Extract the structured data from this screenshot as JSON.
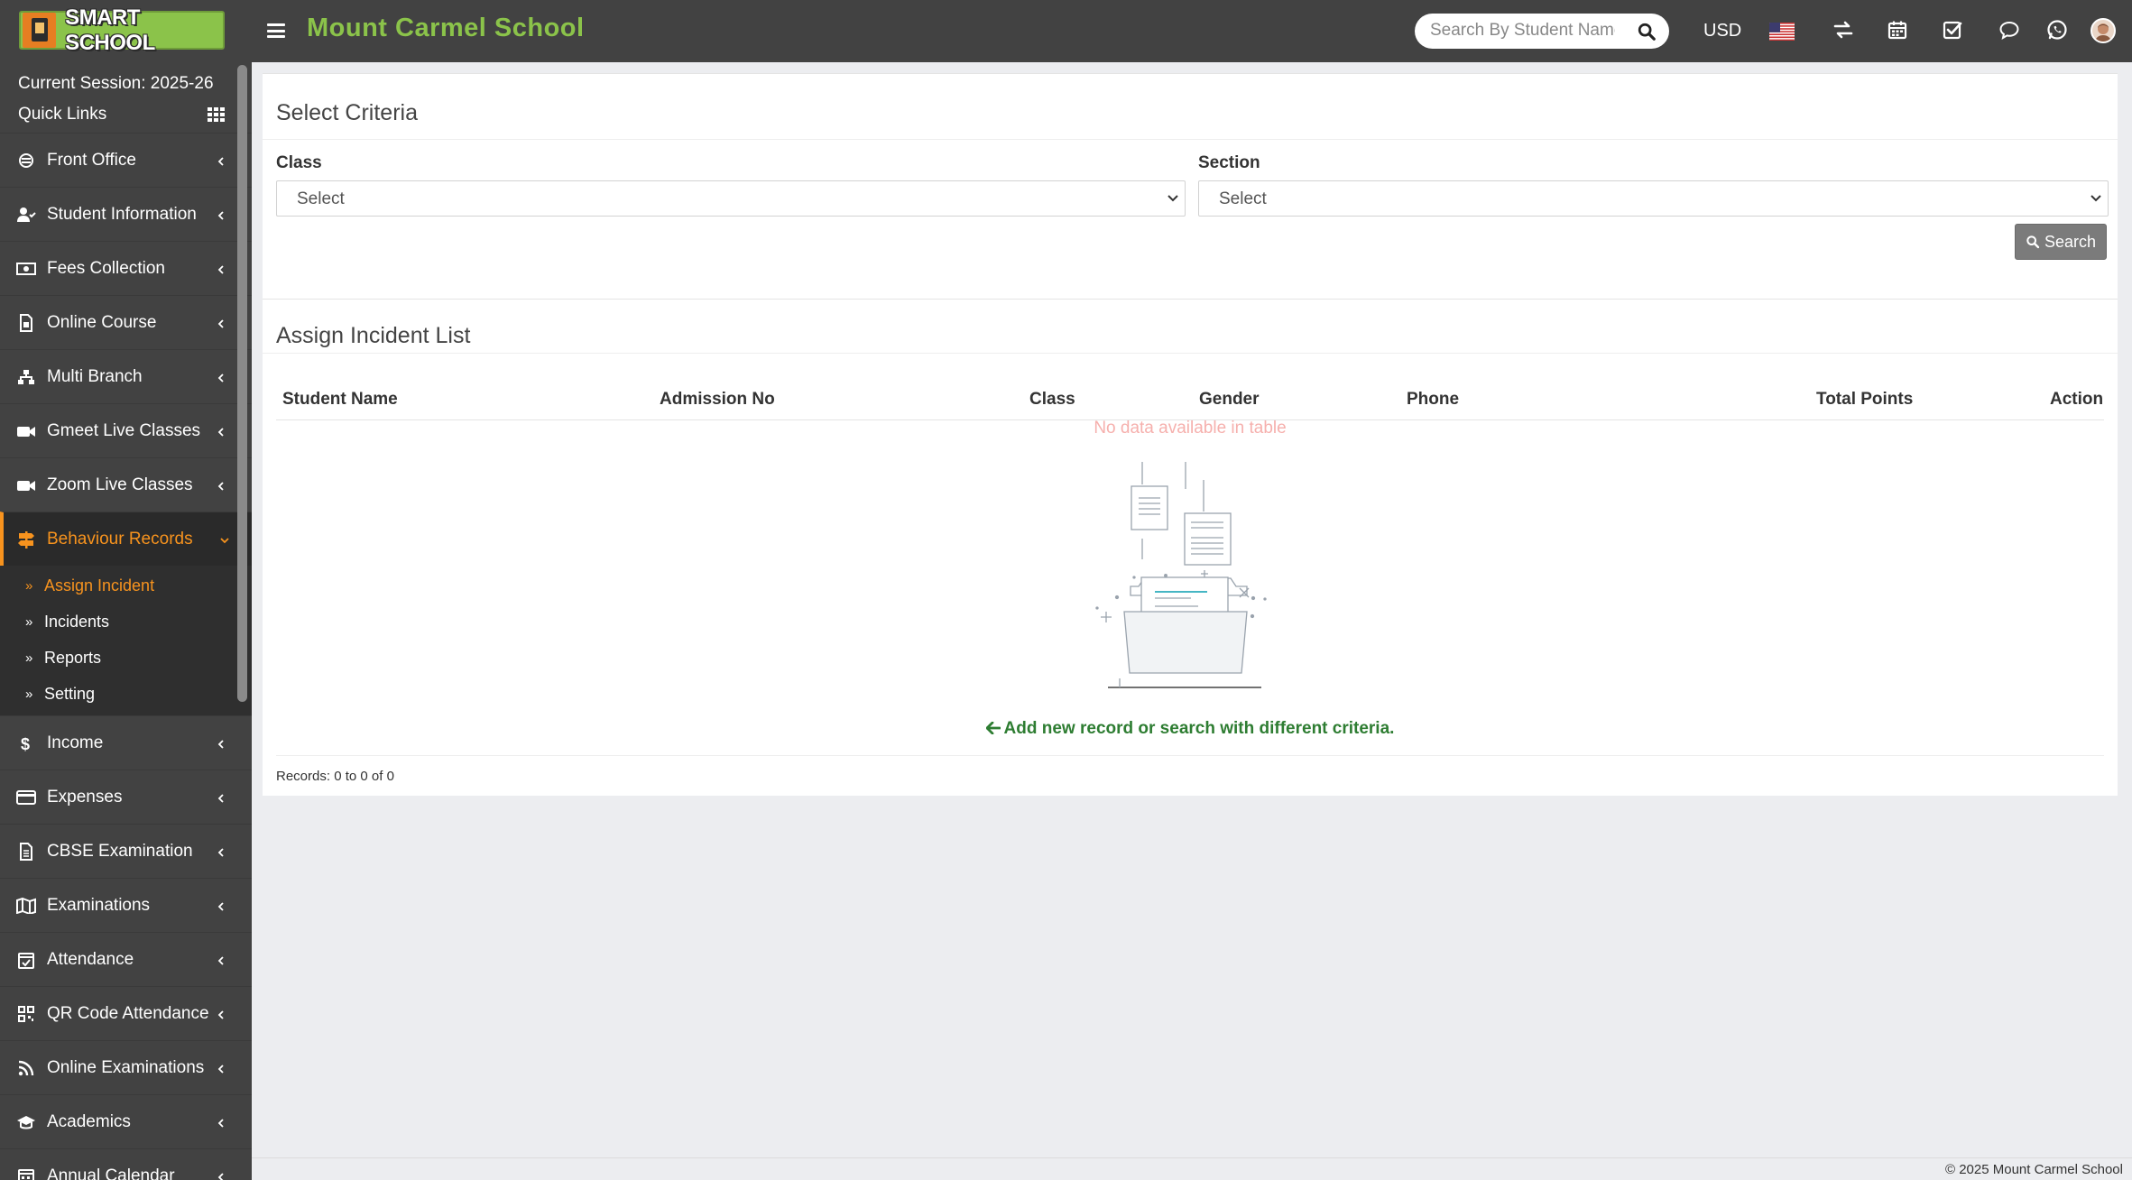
{
  "header": {
    "logo_text": "SMART SCHOOL",
    "school_name": "Mount Carmel School",
    "search_placeholder": "Search By Student Name",
    "currency": "USD"
  },
  "sidebar": {
    "session_label": "Current Session: 2025-26",
    "quick_links": "Quick Links",
    "items": [
      {
        "label": "Front Office",
        "icon": "front-office-icon"
      },
      {
        "label": "Student Information",
        "icon": "student-icon"
      },
      {
        "label": "Fees Collection",
        "icon": "money-icon"
      },
      {
        "label": "Online Course",
        "icon": "file-icon"
      },
      {
        "label": "Multi Branch",
        "icon": "sitemap-icon"
      },
      {
        "label": "Gmeet Live Classes",
        "icon": "video-icon"
      },
      {
        "label": "Zoom Live Classes",
        "icon": "video-icon"
      },
      {
        "label": "Behaviour Records",
        "icon": "signpost-icon"
      },
      {
        "label": "Income",
        "icon": "dollar-icon"
      },
      {
        "label": "Expenses",
        "icon": "credit-card-icon"
      },
      {
        "label": "CBSE Examination",
        "icon": "document-icon"
      },
      {
        "label": "Examinations",
        "icon": "map-icon"
      },
      {
        "label": "Attendance",
        "icon": "calendar-check-icon"
      },
      {
        "label": "QR Code Attendance",
        "icon": "qrcode-icon"
      },
      {
        "label": "Online Examinations",
        "icon": "rss-icon"
      },
      {
        "label": "Academics",
        "icon": "graduation-cap-icon"
      },
      {
        "label": "Annual Calendar",
        "icon": "calendar-icon"
      }
    ],
    "submenu": [
      {
        "label": "Assign Incident"
      },
      {
        "label": "Incidents"
      },
      {
        "label": "Reports"
      },
      {
        "label": "Setting"
      }
    ]
  },
  "criteria": {
    "title": "Select Criteria",
    "class_label": "Class",
    "class_value": "Select",
    "section_label": "Section",
    "section_value": "Select",
    "search_button": "Search"
  },
  "list": {
    "title": "Assign Incident List",
    "columns": [
      "Student Name",
      "Admission No",
      "Class",
      "Gender",
      "Phone",
      "Total Points",
      "Action"
    ],
    "no_data": "No data available in table",
    "add_new": "Add new record or search with different criteria.",
    "records": "Records: 0 to 0 of 0"
  },
  "footer": {
    "copyright": "© 2025 Mount Carmel School"
  },
  "colors": {
    "topbar": "#424242",
    "brand_green": "#8bc34a",
    "active_orange": "#f7931e",
    "no_data_pink": "#f6b0ad",
    "add_new_green": "#2e7d32"
  }
}
